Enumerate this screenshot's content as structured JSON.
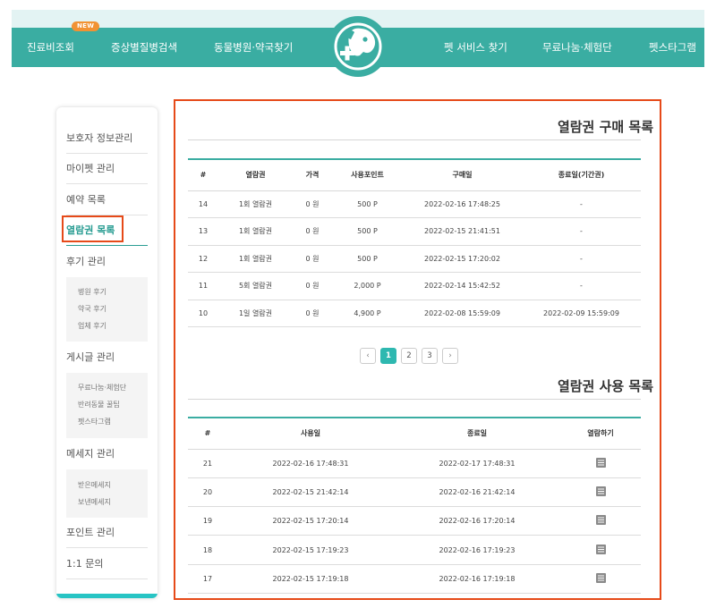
{
  "nav": {
    "items": [
      {
        "label": "진료비조회"
      },
      {
        "label": "증상별질병검색"
      },
      {
        "label": "동물병원·약국찾기"
      },
      {
        "label": "펫 서비스 찾기"
      },
      {
        "label": "무료나눔·체험단"
      },
      {
        "label": "펫스타그램"
      }
    ],
    "new_badge": "NEW",
    "logo_icon": "pet-cross-logo-icon"
  },
  "sidebar": {
    "items": [
      {
        "label": "보호자 정보관리"
      },
      {
        "label": "마이펫 관리"
      },
      {
        "label": "예약 목록"
      },
      {
        "label": "열람권 목록"
      },
      {
        "label": "후기 관리"
      },
      {
        "label": "게시글 관리"
      },
      {
        "label": "메세지 관리"
      },
      {
        "label": "포인트 관리"
      },
      {
        "label": "1:1 문의"
      }
    ],
    "review_sub": [
      "병원 후기",
      "약국 후기",
      "업체 후기"
    ],
    "post_sub": [
      "무료나눔·체험단",
      "반려동물 꿀팁",
      "펫스타그램"
    ],
    "message_sub": [
      "받은메세지",
      "보낸메세지"
    ],
    "active_index": 3
  },
  "purchase": {
    "title": "열람권 구매 목록",
    "headers": [
      "#",
      "열람권",
      "가격",
      "사용포인트",
      "구매일",
      "종료일(기간권)"
    ],
    "rows": [
      [
        "14",
        "1회 열람권",
        "0 원",
        "500 P",
        "2022-02-16 17:48:25",
        "-"
      ],
      [
        "13",
        "1회 열람권",
        "0 원",
        "500 P",
        "2022-02-15 21:41:51",
        "-"
      ],
      [
        "12",
        "1회 열람권",
        "0 원",
        "500 P",
        "2022-02-15 17:20:02",
        "-"
      ],
      [
        "11",
        "5회 열람권",
        "0 원",
        "2,000 P",
        "2022-02-14 15:42:52",
        "-"
      ],
      [
        "10",
        "1일 열람권",
        "0 원",
        "4,900 P",
        "2022-02-08 15:59:09",
        "2022-02-09 15:59:09"
      ]
    ]
  },
  "pagination": {
    "prev": "‹",
    "pages": [
      "1",
      "2",
      "3"
    ],
    "next": "›",
    "current": "1"
  },
  "usage": {
    "title": "열람권 사용 목록",
    "headers": [
      "#",
      "사용일",
      "종료일",
      "열람하기"
    ],
    "rows": [
      [
        "21",
        "2022-02-16 17:48:31",
        "2022-02-17 17:48:31"
      ],
      [
        "20",
        "2022-02-15 21:42:14",
        "2022-02-16 21:42:14"
      ],
      [
        "19",
        "2022-02-15 17:20:14",
        "2022-02-16 17:20:14"
      ],
      [
        "18",
        "2022-02-15 17:19:23",
        "2022-02-16 17:19:23"
      ],
      [
        "17",
        "2022-02-15 17:19:18",
        "2022-02-16 17:19:18"
      ]
    ],
    "view_icon": "document-icon"
  },
  "colors": {
    "brand": "#3aada2",
    "accent_pager": "#2eb8b0",
    "highlight": "#e64a19",
    "new_badge": "#f19233"
  }
}
